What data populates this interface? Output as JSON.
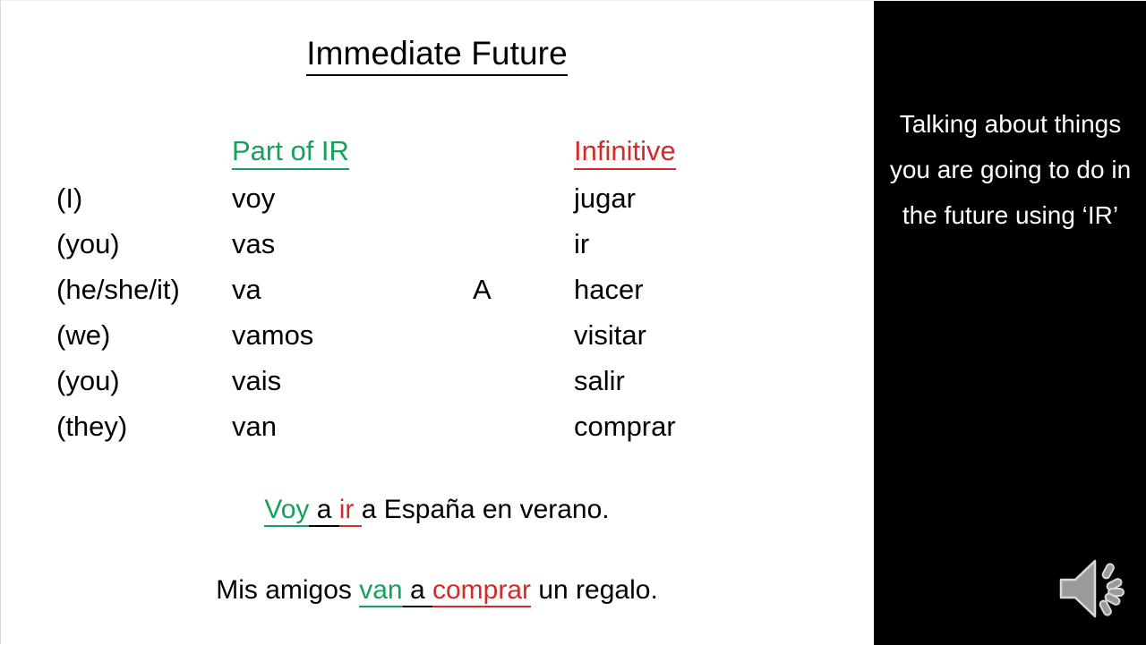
{
  "slide": {
    "title": "Immediate Future",
    "background_color": "#ffffff",
    "panel_color": "#000000",
    "accent_green": "#16a05a",
    "accent_red": "#d42a2a"
  },
  "table": {
    "headers": {
      "pronoun": "",
      "ir": "Part of IR",
      "connector": "",
      "infinitive": "Infinitive"
    },
    "rows": [
      {
        "pronoun": "(I)",
        "ir": "voy",
        "connector": "",
        "infinitive": "jugar"
      },
      {
        "pronoun": "(you)",
        "ir": "vas",
        "connector": "",
        "infinitive": "ir"
      },
      {
        "pronoun": "(he/she/it)",
        "ir": "va",
        "connector": "A",
        "infinitive": "hacer"
      },
      {
        "pronoun": "(we)",
        "ir": "vamos",
        "connector": "",
        "infinitive": "visitar"
      },
      {
        "pronoun": "(you)",
        "ir": "vais",
        "connector": "",
        "infinitive": "salir"
      },
      {
        "pronoun": "(they)",
        "ir": "van",
        "connector": "",
        "infinitive": "comprar"
      }
    ]
  },
  "examples": [
    {
      "full_text": "Voy a ir a España en verano.",
      "segments": {
        "ir_part": "Voy",
        "connector": " a ",
        "infinitive": "ir ",
        "rest": "a España en verano."
      }
    },
    {
      "full_text": "Mis amigos van a comprar un regalo.",
      "segments": {
        "lead": "Mis amigos ",
        "ir_part": "van",
        "connector": " a ",
        "infinitive": "comprar",
        "rest": " un regalo."
      }
    }
  ],
  "right_panel": {
    "caption": "Talking about things you are going to do in the future using ‘IR’",
    "audio_icon_label": "speaker-icon"
  }
}
